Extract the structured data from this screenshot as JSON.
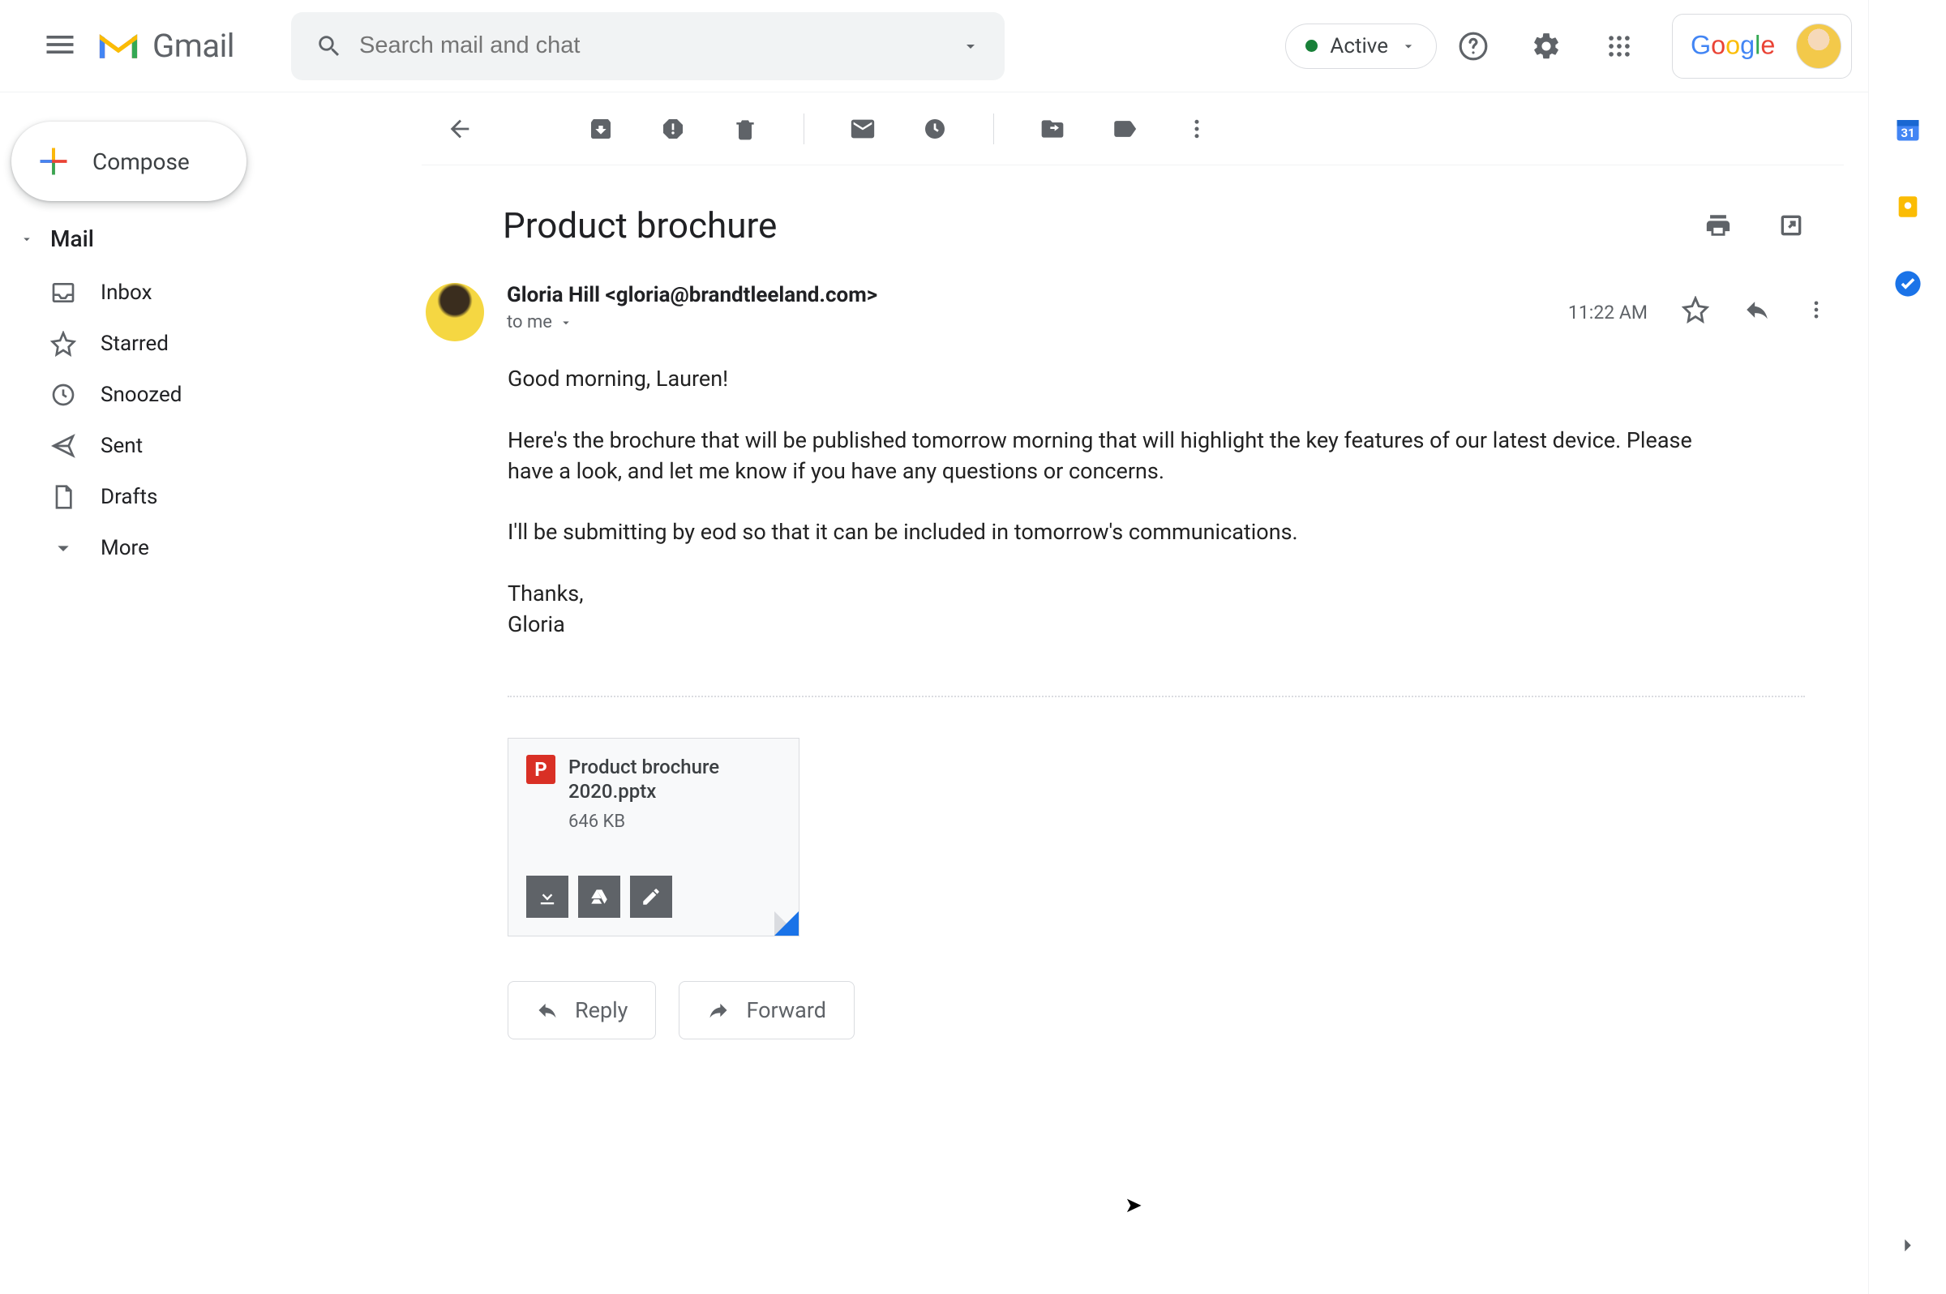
{
  "header": {
    "app_name": "Gmail",
    "search_placeholder": "Search mail and chat",
    "status_label": "Active",
    "google_label": "Google"
  },
  "sidebar": {
    "compose_label": "Compose",
    "section_label": "Mail",
    "items": [
      {
        "label": "Inbox"
      },
      {
        "label": "Starred"
      },
      {
        "label": "Snoozed"
      },
      {
        "label": "Sent"
      },
      {
        "label": "Drafts"
      },
      {
        "label": "More"
      }
    ]
  },
  "email": {
    "subject": "Product brochure",
    "from_display": "Gloria Hill <gloria@brandtleeland.com>",
    "to_display": "to me",
    "timestamp": "11:22 AM",
    "body": {
      "greeting": "Good morning, Lauren!",
      "p1": "Here's the brochure that will be published tomorrow morning that will highlight the key features of our latest device. Please have a look, and let me know if you have any questions or concerns.",
      "p2": "I'll be submitting by eod so that it can be included in tomorrow's communications.",
      "signoff": "Thanks,",
      "signature": "Gloria"
    },
    "attachment": {
      "filename": "Product brochure 2020.pptx",
      "size": "646 KB",
      "icon_letter": "P"
    },
    "actions": {
      "reply_label": "Reply",
      "forward_label": "Forward"
    }
  }
}
